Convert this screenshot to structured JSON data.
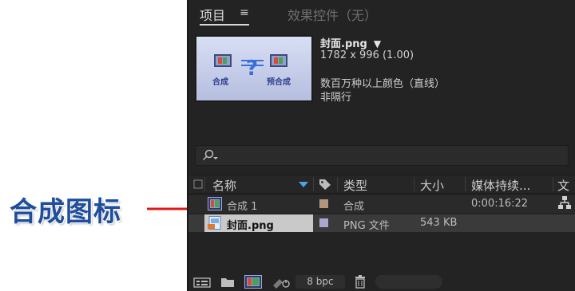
{
  "annotation": {
    "label": "合成图标"
  },
  "panel": {
    "tabs": [
      {
        "label": "项目"
      },
      {
        "label": "效果控件（无）"
      }
    ],
    "tab_menu_glyph": "≡",
    "selected_file": {
      "name": "封面.png",
      "dropdown_glyph": "▼",
      "dimensions": "1782 x 996 (1.00)",
      "color": "数百万种以上颜色（直线）",
      "interlace": "非隔行"
    },
    "thumbnail": {
      "left_text": "合成",
      "right_text": "预合成"
    },
    "search": {
      "icon": "search-icon"
    },
    "columns": [
      {
        "label": "名称"
      },
      {
        "label": "类型"
      },
      {
        "label": "大小"
      },
      {
        "label": "媒体持续..."
      },
      {
        "label": "文"
      }
    ],
    "rows": [
      {
        "name": "合成 1",
        "type": "合成",
        "size": "",
        "duration": "0:00:16:22",
        "label_color": "#b4977a"
      },
      {
        "name": "封面.png",
        "type": "PNG 文件",
        "size": "543 KB",
        "duration": "",
        "label_color": "#a9a6cf"
      }
    ],
    "footer": {
      "bpc": "8 bpc"
    }
  },
  "colors": {
    "annotation_text": "#1f4e9d",
    "arrow": "#e01818",
    "panel_bg": "#232323"
  }
}
